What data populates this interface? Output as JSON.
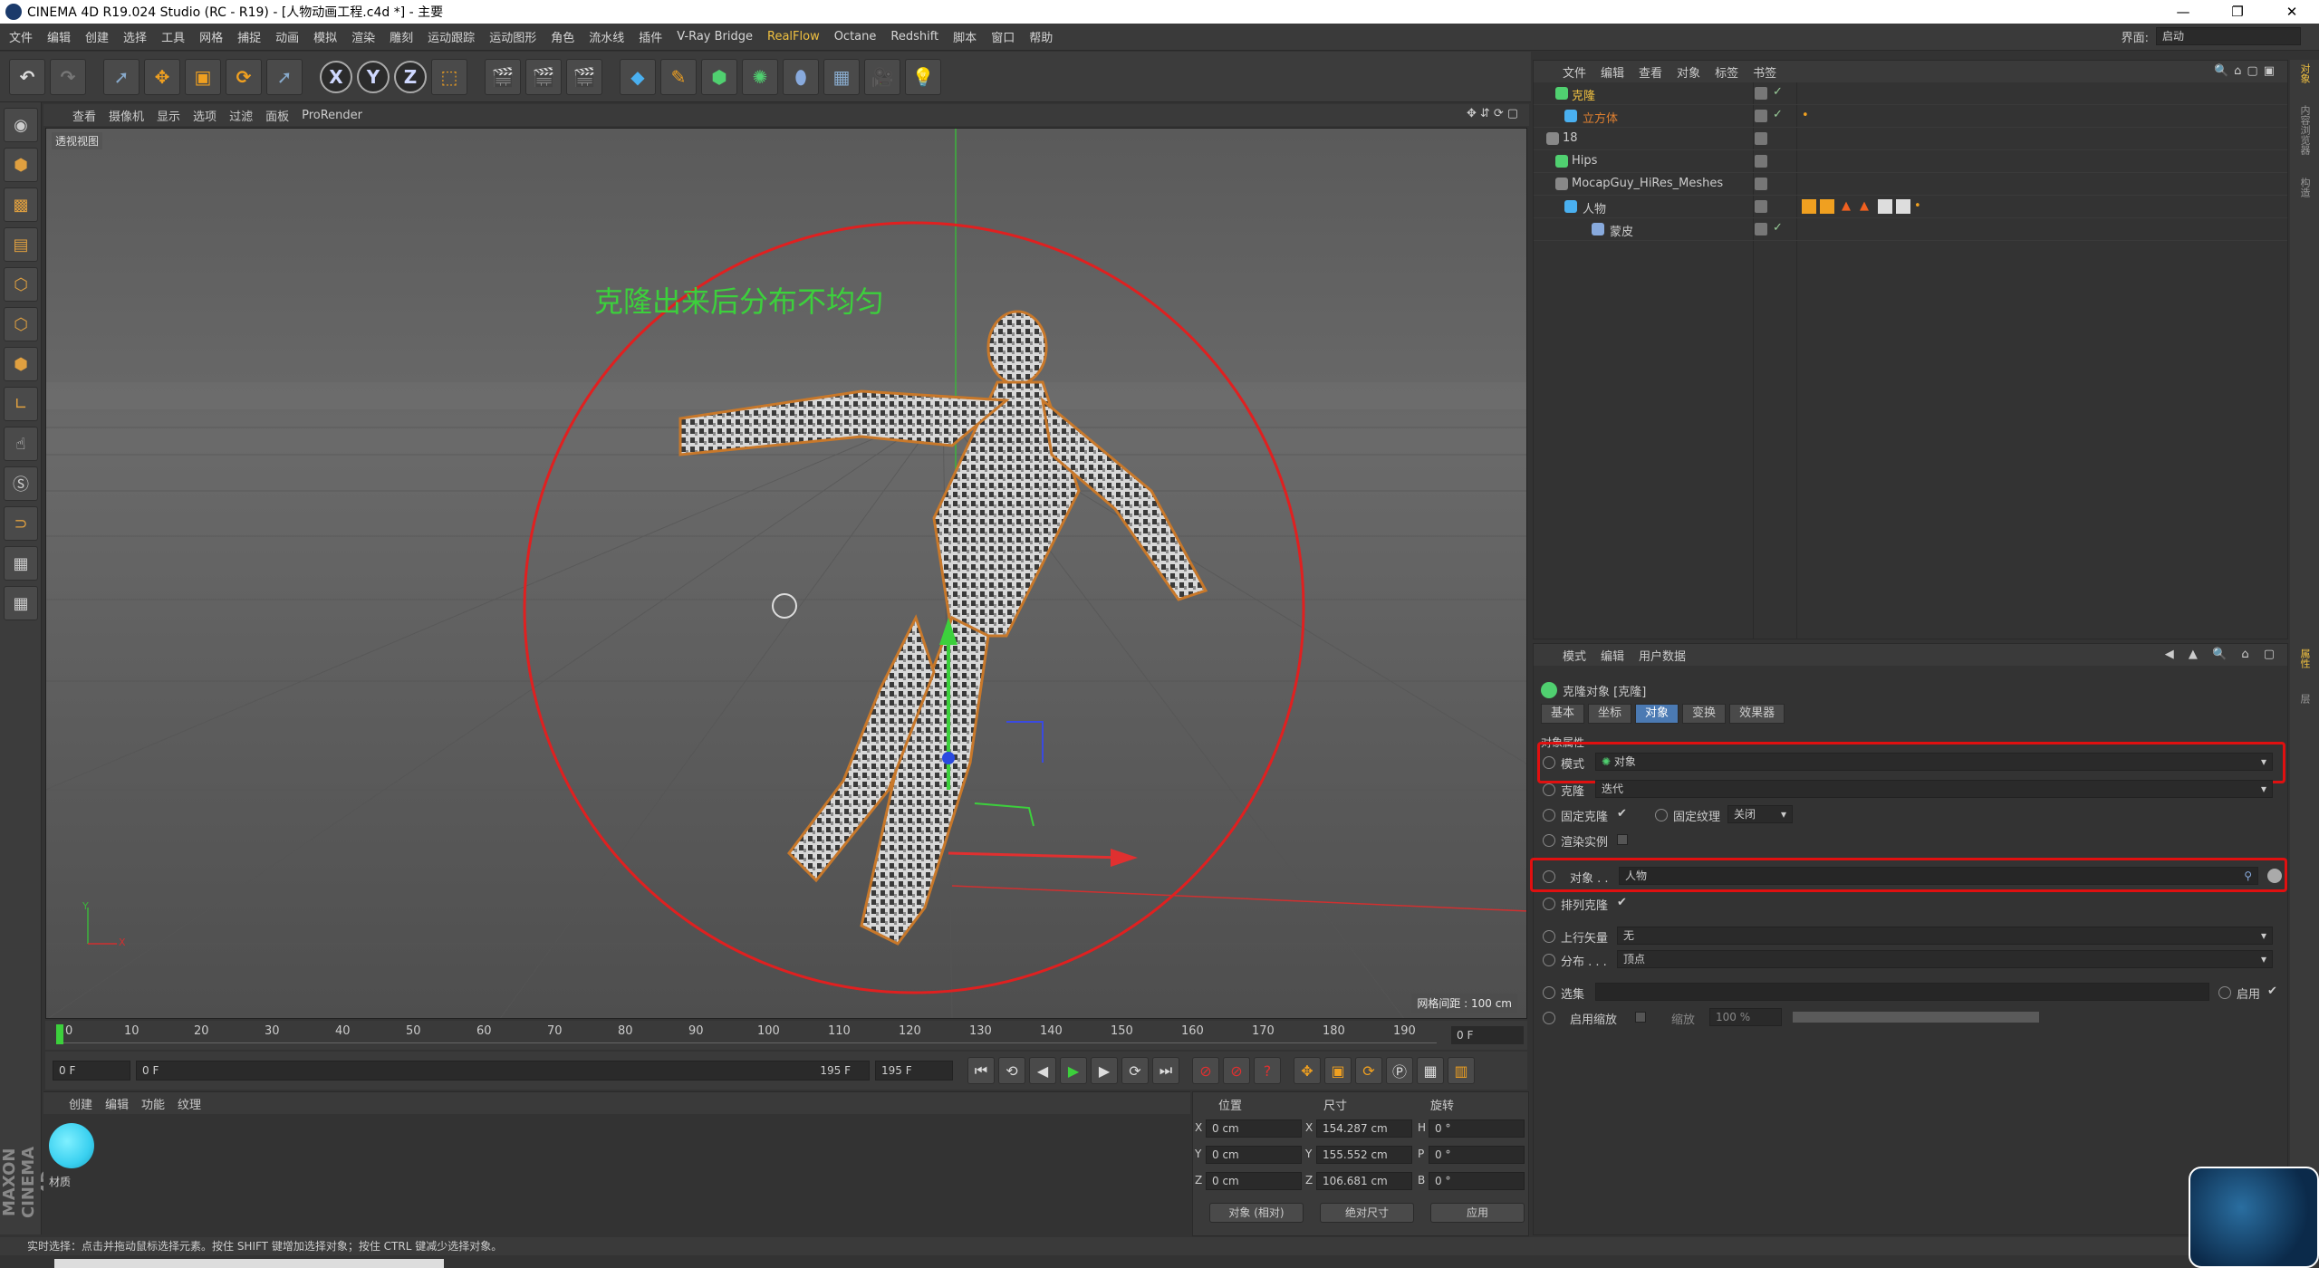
{
  "titlebar": {
    "title": "CINEMA 4D R19.024 Studio (RC - R19) - [人物动画工程.c4d *] - 主要",
    "min": "—",
    "max": "❐",
    "close": "✕"
  },
  "menubar": {
    "items": [
      "文件",
      "编辑",
      "创建",
      "选择",
      "工具",
      "网格",
      "捕捉",
      "动画",
      "模拟",
      "渲染",
      "雕刻",
      "运动跟踪",
      "运动图形",
      "角色",
      "流水线",
      "插件",
      "V-Ray Bridge",
      "RealFlow",
      "Octane",
      "Redshift",
      "脚本",
      "窗口",
      "帮助"
    ],
    "highlight_index": 17,
    "layout_label": "界面:",
    "layout_value": "启动"
  },
  "toolbar": {
    "axis_x": "X",
    "axis_y": "Y",
    "axis_z": "Z"
  },
  "viewport": {
    "menu": [
      "查看",
      "摄像机",
      "显示",
      "选项",
      "过滤",
      "面板",
      "ProRender"
    ],
    "label": "透视视图",
    "annotation": "克隆出来后分布不均匀",
    "grid_spacing": "网格间距 : 100 cm",
    "axis_y": "Y",
    "axis_x": "X"
  },
  "timeline": {
    "ticks": [
      "0",
      "10",
      "20",
      "30",
      "40",
      "50",
      "60",
      "70",
      "80",
      "90",
      "100",
      "110",
      "120",
      "130",
      "140",
      "150",
      "160",
      "170",
      "180",
      "190"
    ],
    "current_frame": "0 F"
  },
  "transport": {
    "start": "0 F",
    "range_start": "0 F",
    "range_end": "195 F",
    "end": "195 F"
  },
  "material_manager": {
    "menu": [
      "创建",
      "编辑",
      "功能",
      "纹理"
    ],
    "material_name": "材质"
  },
  "coord_manager": {
    "headers": [
      "位置",
      "尺寸",
      "旋转"
    ],
    "rows": [
      {
        "axis": "X",
        "pos": "0 cm",
        "size_axis": "X",
        "size": "154.287 cm",
        "rot_axis": "H",
        "rot": "0 °"
      },
      {
        "axis": "Y",
        "pos": "0 cm",
        "size_axis": "Y",
        "size": "155.552 cm",
        "rot_axis": "P",
        "rot": "0 °"
      },
      {
        "axis": "Z",
        "pos": "0 cm",
        "size_axis": "Z",
        "size": "106.681 cm",
        "rot_axis": "B",
        "rot": "0 °"
      }
    ],
    "mode": "对象 (相对)",
    "size_mode": "绝对尺寸",
    "apply": "应用"
  },
  "statusbar": {
    "text": "实时选择：点击并拖动鼠标选择元素。按住 SHIFT 键增加选择对象；按住 CTRL 键减少选择对象。"
  },
  "object_manager": {
    "menu": [
      "文件",
      "编辑",
      "查看",
      "对象",
      "标签",
      "书签"
    ],
    "objects": [
      {
        "name": "克隆",
        "color": "#f0c040"
      },
      {
        "name": "立方体",
        "color": "#e08030"
      },
      {
        "name": "18",
        "color": "#cccccc"
      },
      {
        "name": "Hips",
        "color": "#cccccc"
      },
      {
        "name": "MocapGuy_HiRes_Meshes",
        "color": "#cccccc"
      },
      {
        "name": "人物",
        "color": "#cccccc"
      },
      {
        "name": "蒙皮",
        "color": "#cccccc"
      }
    ]
  },
  "attributes_manager": {
    "menu": [
      "模式",
      "编辑",
      "用户数据"
    ],
    "object_title": "克隆对象 [克隆]",
    "tabs": [
      "基本",
      "坐标",
      "对象",
      "变换",
      "效果器"
    ],
    "active_tab": 2,
    "section": "对象属性",
    "mode_label": "模式",
    "mode_value": "对象",
    "clone_label": "克隆",
    "clone_value": "迭代",
    "fix_clone_label": "固定克隆",
    "fix_clone_check": "✔",
    "fix_texture_label": "固定纹理",
    "fix_texture_value": "关闭",
    "render_instances_label": "渲染实例",
    "object_label": "对象 . .",
    "object_value": "人物",
    "align_clone_label": "排列克隆",
    "align_clone_check": "✔",
    "up_vector_label": "上行矢量",
    "up_vector_value": "无",
    "distribution_label": "分布 . . .",
    "distribution_value": "顶点",
    "selection_label": "选集",
    "enable_label": "启用",
    "enable_check": "✔",
    "enable_scale_label": "启用缩放",
    "scale_label": "缩放",
    "scale_value": "100 %"
  },
  "right_strip": {
    "tabs": [
      "对象",
      "内容浏览器",
      "构造",
      "属性",
      "层"
    ]
  }
}
